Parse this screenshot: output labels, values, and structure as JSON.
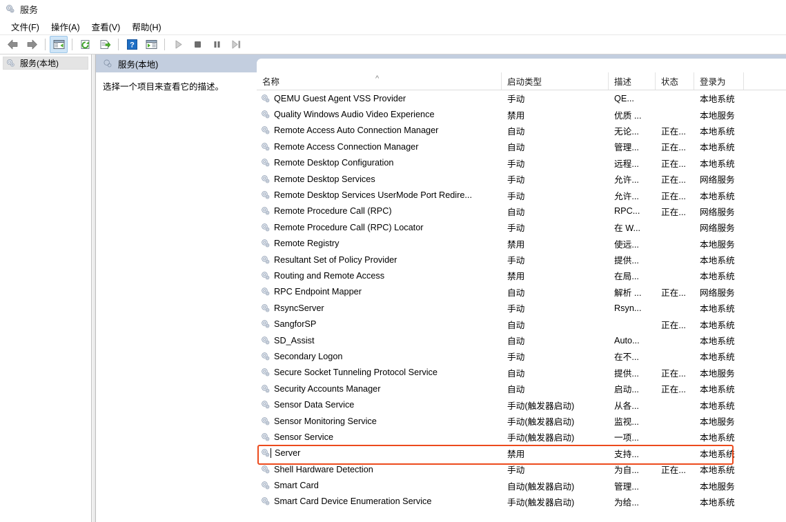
{
  "window": {
    "title": "服务",
    "icon": "services-gear-icon"
  },
  "menu": {
    "items": [
      {
        "label": "文件(F)",
        "name": "menu-file"
      },
      {
        "label": "操作(A)",
        "name": "menu-action"
      },
      {
        "label": "查看(V)",
        "name": "menu-view"
      },
      {
        "label": "帮助(H)",
        "name": "menu-help"
      }
    ]
  },
  "toolbar": {
    "buttons": [
      {
        "name": "back-arrow-icon",
        "glyph": "back",
        "active": false,
        "enabled": true
      },
      {
        "name": "forward-arrow-icon",
        "glyph": "forward",
        "active": false,
        "enabled": true
      },
      {
        "name": "show-hide-tree-icon",
        "glyph": "panel",
        "active": true,
        "enabled": true
      },
      {
        "name": "refresh-icon",
        "glyph": "refresh",
        "active": false,
        "enabled": true
      },
      {
        "name": "export-list-icon",
        "glyph": "export",
        "active": false,
        "enabled": true
      },
      {
        "name": "help-icon",
        "glyph": "help",
        "active": false,
        "enabled": true
      },
      {
        "name": "show-action-pane-icon",
        "glyph": "actionpane",
        "active": false,
        "enabled": true
      },
      {
        "name": "start-service-icon",
        "glyph": "play",
        "active": false,
        "enabled": false
      },
      {
        "name": "stop-service-icon",
        "glyph": "stop",
        "active": false,
        "enabled": false
      },
      {
        "name": "pause-service-icon",
        "glyph": "pause",
        "active": false,
        "enabled": false
      },
      {
        "name": "restart-service-icon",
        "glyph": "restart",
        "active": false,
        "enabled": false
      }
    ]
  },
  "tree": {
    "items": [
      {
        "label": "服务(本地)",
        "name": "tree-item-services-local",
        "selected": true
      }
    ]
  },
  "detail": {
    "header": "服务(本地)",
    "body": "选择一个项目来查看它的描述。"
  },
  "list": {
    "columns": [
      {
        "key": "name",
        "label": "名称",
        "sorted": "asc"
      },
      {
        "key": "start",
        "label": "启动类型",
        "sorted": ""
      },
      {
        "key": "desc",
        "label": "描述",
        "sorted": ""
      },
      {
        "key": "status",
        "label": "状态",
        "sorted": ""
      },
      {
        "key": "logon",
        "label": "登录为",
        "sorted": ""
      }
    ],
    "sort_indicator": "^",
    "rows": [
      {
        "name": "QEMU Guest Agent VSS Provider",
        "start": "手动",
        "desc": "QE...",
        "status": "",
        "logon": "本地系统",
        "highlighted": false
      },
      {
        "name": "Quality Windows Audio Video Experience",
        "start": "禁用",
        "desc": "优质 ...",
        "status": "",
        "logon": "本地服务",
        "highlighted": false
      },
      {
        "name": "Remote Access Auto Connection Manager",
        "start": "自动",
        "desc": "无论...",
        "status": "正在...",
        "logon": "本地系统",
        "highlighted": false
      },
      {
        "name": "Remote Access Connection Manager",
        "start": "自动",
        "desc": "管理...",
        "status": "正在...",
        "logon": "本地系统",
        "highlighted": false
      },
      {
        "name": "Remote Desktop Configuration",
        "start": "手动",
        "desc": "远程...",
        "status": "正在...",
        "logon": "本地系统",
        "highlighted": false
      },
      {
        "name": "Remote Desktop Services",
        "start": "手动",
        "desc": "允许...",
        "status": "正在...",
        "logon": "网络服务",
        "highlighted": false
      },
      {
        "name": "Remote Desktop Services UserMode Port Redire...",
        "start": "手动",
        "desc": "允许...",
        "status": "正在...",
        "logon": "本地系统",
        "highlighted": false
      },
      {
        "name": "Remote Procedure Call (RPC)",
        "start": "自动",
        "desc": "RPC...",
        "status": "正在...",
        "logon": "网络服务",
        "highlighted": false
      },
      {
        "name": "Remote Procedure Call (RPC) Locator",
        "start": "手动",
        "desc": "在 W...",
        "status": "",
        "logon": "网络服务",
        "highlighted": false
      },
      {
        "name": "Remote Registry",
        "start": "禁用",
        "desc": "使远...",
        "status": "",
        "logon": "本地服务",
        "highlighted": false
      },
      {
        "name": "Resultant Set of Policy Provider",
        "start": "手动",
        "desc": "提供...",
        "status": "",
        "logon": "本地系统",
        "highlighted": false
      },
      {
        "name": "Routing and Remote Access",
        "start": "禁用",
        "desc": "在局...",
        "status": "",
        "logon": "本地系统",
        "highlighted": false
      },
      {
        "name": "RPC Endpoint Mapper",
        "start": "自动",
        "desc": "解析 ...",
        "status": "正在...",
        "logon": "网络服务",
        "highlighted": false
      },
      {
        "name": "RsyncServer",
        "start": "手动",
        "desc": "Rsyn...",
        "status": "",
        "logon": "本地系统",
        "highlighted": false
      },
      {
        "name": "SangforSP",
        "start": "自动",
        "desc": "",
        "status": "正在...",
        "logon": "本地系统",
        "highlighted": false
      },
      {
        "name": "SD_Assist",
        "start": "自动",
        "desc": "Auto...",
        "status": "",
        "logon": "本地系统",
        "highlighted": false
      },
      {
        "name": "Secondary Logon",
        "start": "手动",
        "desc": "在不...",
        "status": "",
        "logon": "本地系统",
        "highlighted": false
      },
      {
        "name": "Secure Socket Tunneling Protocol Service",
        "start": "自动",
        "desc": "提供...",
        "status": "正在...",
        "logon": "本地服务",
        "highlighted": false
      },
      {
        "name": "Security Accounts Manager",
        "start": "自动",
        "desc": "启动...",
        "status": "正在...",
        "logon": "本地系统",
        "highlighted": false
      },
      {
        "name": "Sensor Data Service",
        "start": "手动(触发器启动)",
        "desc": "从各...",
        "status": "",
        "logon": "本地系统",
        "highlighted": false
      },
      {
        "name": "Sensor Monitoring Service",
        "start": "手动(触发器启动)",
        "desc": "监视...",
        "status": "",
        "logon": "本地服务",
        "highlighted": false
      },
      {
        "name": "Sensor Service",
        "start": "手动(触发器启动)",
        "desc": "一项...",
        "status": "",
        "logon": "本地系统",
        "highlighted": false
      },
      {
        "name": "Server",
        "start": "禁用",
        "desc": "支持...",
        "status": "",
        "logon": "本地系统",
        "highlighted": true
      },
      {
        "name": "Shell Hardware Detection",
        "start": "手动",
        "desc": "为自...",
        "status": "正在...",
        "logon": "本地系统",
        "highlighted": false
      },
      {
        "name": "Smart Card",
        "start": "自动(触发器启动)",
        "desc": "管理...",
        "status": "",
        "logon": "本地服务",
        "highlighted": false
      },
      {
        "name": "Smart Card Device Enumeration Service",
        "start": "手动(触发器启动)",
        "desc": "为给...",
        "status": "",
        "logon": "本地系统",
        "highlighted": false
      },
      {
        "name": "",
        "start": "",
        "desc": "",
        "status": "",
        "logon": "",
        "highlighted": false
      }
    ],
    "annotation": {
      "target_row": "Server",
      "color": "#ec4a1c"
    }
  },
  "colors": {
    "header_band": "#c3cedf",
    "annotation_red": "#ec4a1c",
    "tree_selection": "#e4e4e4"
  }
}
